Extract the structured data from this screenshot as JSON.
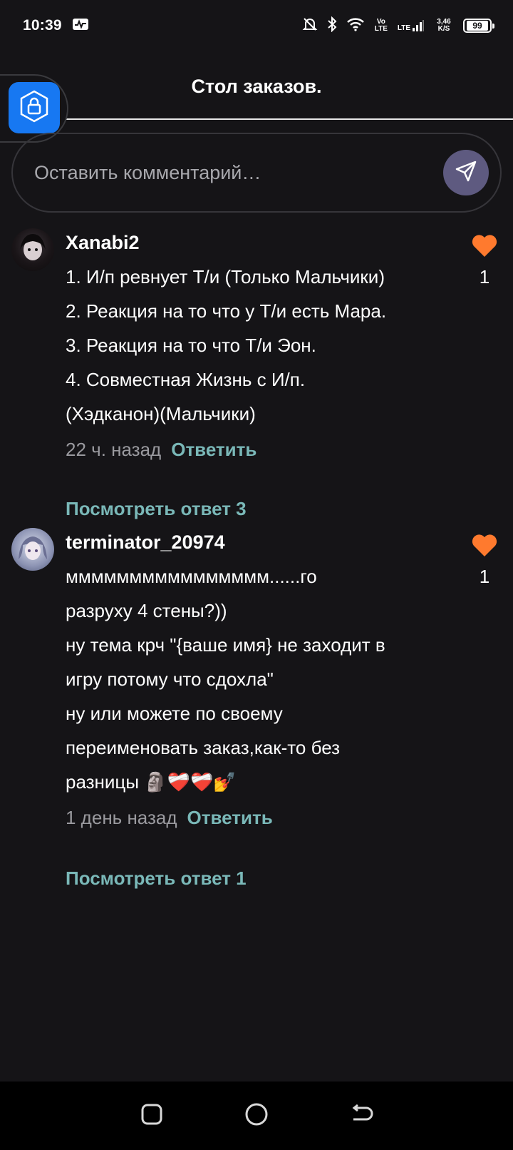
{
  "status_bar": {
    "time": "10:39",
    "volte": "Vo LTE",
    "lte": "LTE",
    "speed": "3,46 K/S",
    "battery": "99"
  },
  "header": {
    "title": "Стол заказов."
  },
  "comment_box": {
    "placeholder": "Оставить комментарий…"
  },
  "comments": [
    {
      "username": "Xanabi2",
      "lines": [
        "1. И/п ревнует Т/и (Только Мальчики)",
        "2. Реакция на то что у Т/и есть Мара.",
        "3. Реакция на то что Т/и Эон.",
        "4. Совместная Жизнь с И/п.",
        "(Хэдканон)(Мальчики)"
      ],
      "time": "22 ч. назад",
      "reply_label": "Ответить",
      "likes": "1",
      "view_replies": "Посмотреть ответ 3"
    },
    {
      "username": "terminator_20974",
      "lines": [
        "мммммммммммммммм......го",
        "разруху 4 стены?))",
        "ну тема крч \"{ваше имя} не заходит в",
        "игру потому что сдохла\"",
        "ну или можете по своему",
        "переименовать заказ,как-то без",
        "разницы 🗿❤️‍🩹❤️‍🩹💅"
      ],
      "time": "1 день назад",
      "reply_label": "Ответить",
      "likes": "1",
      "view_replies": "Посмотреть ответ 1"
    }
  ],
  "colors": {
    "background": "#151417",
    "accent_teal": "#7ab8b8",
    "like_orange": "#ff7a2e",
    "send_button": "#5e5a80",
    "lock_blue": "#1778f2"
  },
  "icons": {
    "lock": "lock-icon",
    "send": "send-icon",
    "like": "heart-icon",
    "nav_recent": "square-icon",
    "nav_home": "circle-icon",
    "nav_back": "back-arrow-icon"
  }
}
